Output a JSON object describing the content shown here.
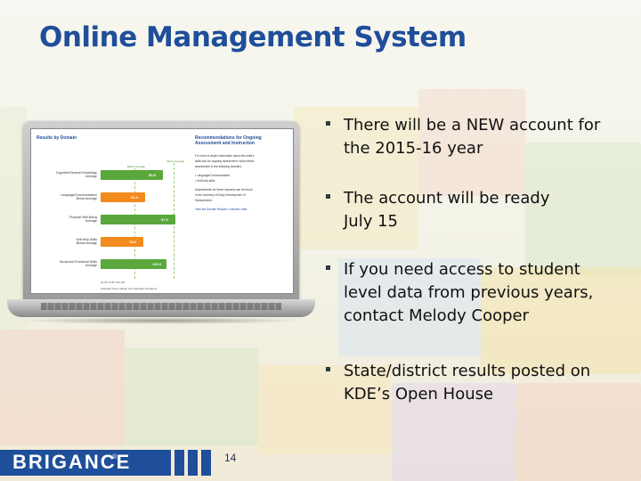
{
  "slide": {
    "title": "Online Management System",
    "page_number": "14",
    "logo_text": "BRIGANCE",
    "logo_mark": "®"
  },
  "bullets": [
    {
      "lines": [
        "There will be a NEW account for",
        "the 2015-16 year"
      ]
    },
    {
      "lines": [
        "The account will be ready",
        "July 15"
      ]
    },
    {
      "lines": [
        "If you need access to student",
        "level data from previous years,",
        "contact Melody Cooper"
      ]
    },
    {
      "lines": [
        "State/district results posted on",
        "KDE’s Open House"
      ]
    }
  ],
  "screen": {
    "left_heading": "Results by Domain",
    "right_heading_lines": [
      "Recommendations for Ongoing",
      "Assessment and Instruction"
    ],
    "legend": [
      "Below Average",
      "Above Average"
    ],
    "rows": [
      {
        "label_lines": [
          "Cognitive/General Knowledge",
          "Average"
        ],
        "value": "90.8",
        "fraction": 0.58,
        "color": "#5aa83c"
      },
      {
        "label_lines": [
          "Language/Communication",
          "Below Average"
        ],
        "value": "81.4",
        "fraction": 0.42,
        "color": "#f28a1e"
      },
      {
        "label_lines": [
          "Physical Well-Being",
          "Average"
        ],
        "value": "97.3",
        "fraction": 0.7,
        "color": "#5aa83c"
      },
      {
        "label_lines": [
          "Self-Help Skills",
          "Below Average"
        ],
        "value": "79.8",
        "fraction": 0.4,
        "color": "#f28a1e"
      },
      {
        "label_lines": [
          "Social and Emotional Skills",
          "Average"
        ],
        "value": "100.0",
        "fraction": 0.62,
        "color": "#5aa83c"
      }
    ],
    "axis_ticks": "40     55     70     85     100     115",
    "caption": "Standard Score (Mean and Standard Deviation)",
    "right_text": [
      "For more in-depth information about this child's",
      "skills and for ongoing assessment, follow these",
      "assessment in the following domains:",
      "• Language/Communication",
      "• Self-help skills",
      "Assessments for these domains can be found",
      "in the Inventory of Early Development III",
      "Standardized.",
      "View the Domain Results / Indicator chart"
    ]
  }
}
